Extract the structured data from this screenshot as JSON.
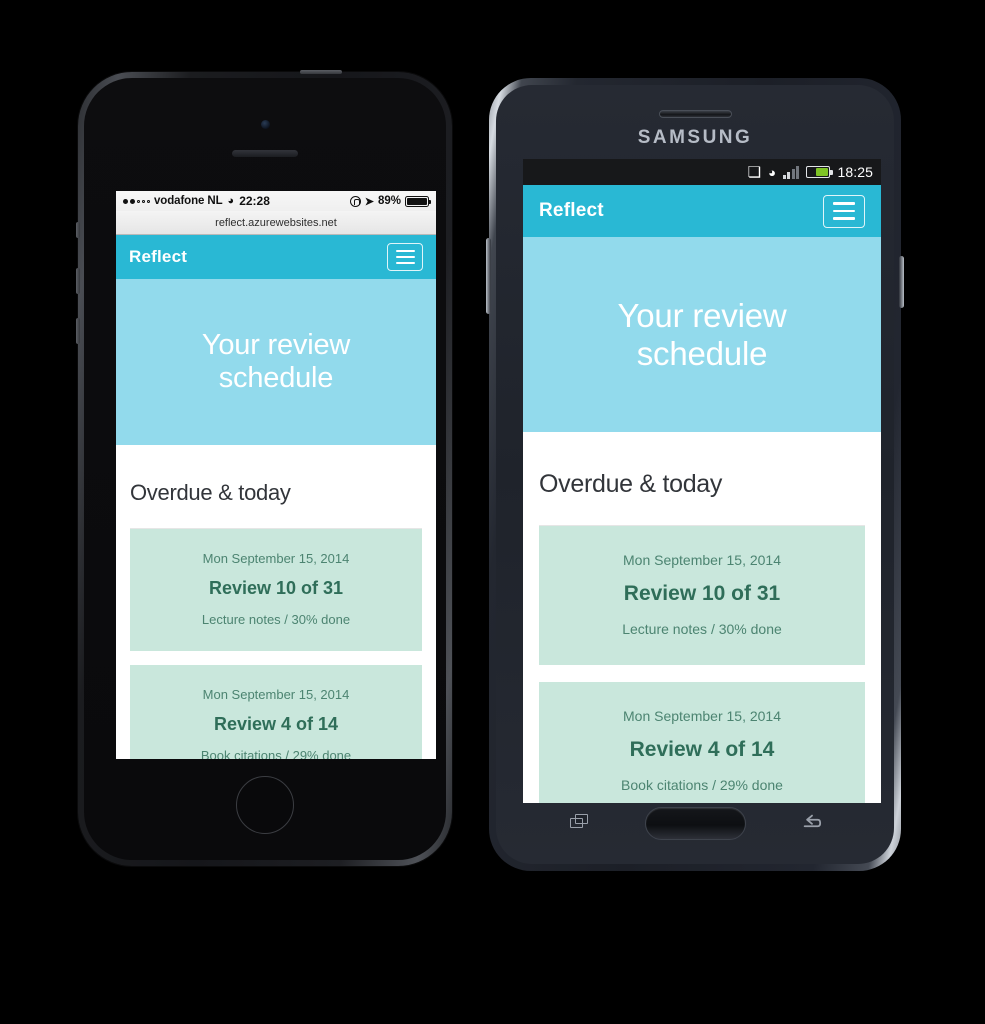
{
  "app": {
    "brand": "Reflect",
    "hero_line1": "Your review",
    "hero_line2": "schedule",
    "section_title": "Overdue & today",
    "menu_icon": "hamburger-icon",
    "cards": [
      {
        "date": "Mon September 15, 2014",
        "title": "Review 10 of 31",
        "meta": "Lecture notes / 30% done"
      },
      {
        "date": "Mon September 15, 2014",
        "title": "Review 4 of 14",
        "meta": "Book citations / 29% done"
      }
    ],
    "colors": {
      "navbar": "#29b8d4",
      "hero": "#92daec",
      "card": "#c9e7dc",
      "card_text": "#2f6e59"
    }
  },
  "iphone": {
    "status": {
      "signal_dots_filled": 2,
      "signal_dots_hollow": 3,
      "carrier": "vodafone NL",
      "wifi_icon": "wifi-icon",
      "time": "22:28",
      "lock_icon": "rotation-lock-icon",
      "location_icon": "location-arrow-icon",
      "battery_percent": "89%"
    },
    "browser": {
      "url": "reflect.azurewebsites.net"
    },
    "hardware": {
      "camera": "front-camera",
      "speaker": "earpiece-speaker",
      "home_button": "home-button"
    }
  },
  "samsung": {
    "logo": "SAMSUNG",
    "status": {
      "bluetooth_icon": "bluetooth-icon",
      "wifi_icon": "wifi-icon",
      "signal_icon": "cell-signal-icon",
      "battery_icon": "battery-icon",
      "time": "18:25"
    },
    "nav": {
      "recents": "recents-icon",
      "home": "home-button",
      "back": "back-icon"
    }
  }
}
